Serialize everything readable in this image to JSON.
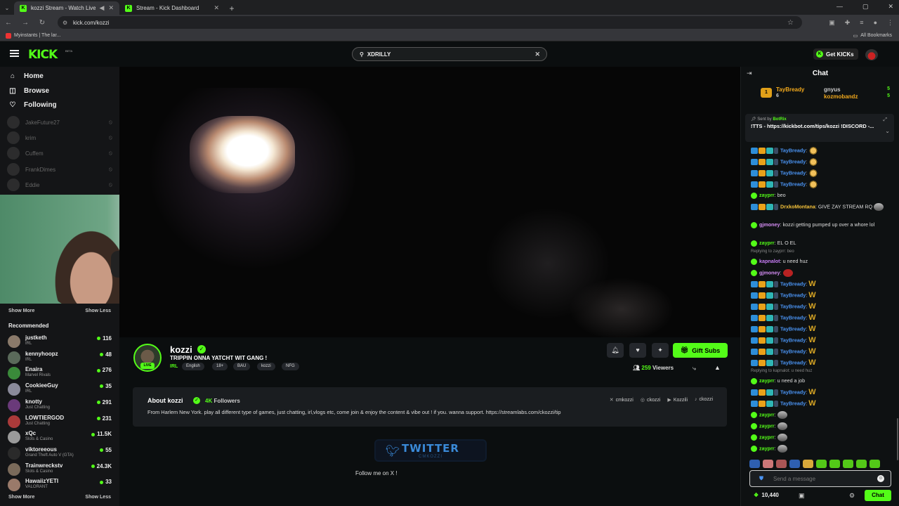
{
  "browser": {
    "tabs": [
      {
        "title": "kozzi Stream - Watch Live o"
      },
      {
        "title": "Stream - Kick Dashboard"
      }
    ],
    "url": "kick.com/kozzi",
    "bookmark": "Myinstants | The lar...",
    "all_bookmarks": "All Bookmarks"
  },
  "header": {
    "logo": "KICK",
    "beta": "BETA",
    "search_value": "XDRILLY",
    "get_kicks": "Get KICKs"
  },
  "sidebar": {
    "nav": [
      {
        "label": "Home",
        "icon": "home-icon"
      },
      {
        "label": "Browse",
        "icon": "compass-icon"
      },
      {
        "label": "Following",
        "icon": "heart-icon"
      }
    ],
    "following": [
      "JakeFuture27",
      "krim",
      "Cuffem",
      "FrankDimes",
      "Eddie"
    ],
    "show_more": "Show More",
    "show_less": "Show Less",
    "recommended_title": "Recommended",
    "recommended": [
      {
        "name": "justketh",
        "category": "IRL",
        "viewers": "116",
        "color": "#8a7a6a"
      },
      {
        "name": "kennyhoopz",
        "category": "IRL",
        "viewers": "48",
        "color": "#5a6a5a"
      },
      {
        "name": "Enaira",
        "category": "Marvel Rivals",
        "viewers": "276",
        "color": "#3a8a3a"
      },
      {
        "name": "CookieeGuy",
        "category": "IRL",
        "viewers": "35",
        "color": "#8a8a9a"
      },
      {
        "name": "knotty",
        "category": "Just Chatting",
        "viewers": "291",
        "color": "#6a3a7a"
      },
      {
        "name": "LOWTIERGOD",
        "category": "Just Chatting",
        "viewers": "231",
        "color": "#aa3a3a"
      },
      {
        "name": "xQc",
        "category": "Slots & Casino",
        "viewers": "11.5K",
        "color": "#9a9a9a"
      },
      {
        "name": "viktoreeous",
        "category": "Grand Theft Auto V (GTA)",
        "viewers": "55",
        "color": "#2a2a2a"
      },
      {
        "name": "Trainwreckstv",
        "category": "Slots & Casino",
        "viewers": "24.3K",
        "color": "#7a6a5a"
      },
      {
        "name": "HawaiizYETI",
        "category": "VALORANT",
        "viewers": "33",
        "color": "#9a7a6a"
      }
    ]
  },
  "stream": {
    "channel": "kozzi",
    "live": "LIVE",
    "title": "TRIPPIN ONNA YATCHT WIT GANG !",
    "category": "IRL",
    "tags": [
      "English",
      "18+",
      "BAU",
      "kozzi",
      "NFG"
    ],
    "gift_subs": "Gift Subs",
    "viewers": "259",
    "viewers_label": "Viewers"
  },
  "about": {
    "title": "About kozzi",
    "followers": "4K",
    "followers_label": "Followers",
    "socials": [
      {
        "icon": "x-icon",
        "glyph": "✕",
        "label": "cmkozzi"
      },
      {
        "icon": "instagram-icon",
        "glyph": "◎",
        "label": "ckozzi"
      },
      {
        "icon": "youtube-icon",
        "glyph": "▶",
        "label": "Kozzili"
      },
      {
        "icon": "tiktok-icon",
        "glyph": "♪",
        "label": "ckozzi"
      }
    ],
    "description": "From Harlem New York. play all different type of games, just chatting, irl,vlogs etc, come join & enjoy the content & vibe out ! if you. wanna support. https://streamlabs.com/ckozzi/tip"
  },
  "panel": {
    "twitter": "TWITTER",
    "handle": "CMKOZZI",
    "follow_text": "Follow me on X !"
  },
  "chat": {
    "title": "Chat",
    "leaderboard": [
      {
        "name": "TayBready",
        "score": "6"
      },
      {
        "name": "gnyus",
        "score": "5"
      },
      {
        "name": "kozmobandz",
        "score": "5"
      }
    ],
    "pinned": {
      "sent_by": "Sent by",
      "bot": "BotRix",
      "message": "!TTS - https://kickbot.com/tips/kozzi !DISCORD -..."
    },
    "messages": [
      {
        "user": "TayBready",
        "cls": "u-tay",
        "text": "",
        "emote": "e-face",
        "badges": true
      },
      {
        "user": "TayBready",
        "cls": "u-tay",
        "text": "",
        "emote": "e-face",
        "badges": true
      },
      {
        "user": "TayBready",
        "cls": "u-tay",
        "text": "",
        "emote": "e-face",
        "badges": true
      },
      {
        "user": "TayBready",
        "cls": "u-tay",
        "text": "",
        "emote": "e-face",
        "badges": true
      },
      {
        "user": "zayprr",
        "cls": "u-zay",
        "text": "beo",
        "emote": "",
        "badges": false
      },
      {
        "user": "DrxkoMontana",
        "cls": "u-drx",
        "text": "GIVE ZAY STREAM RQ",
        "emote": "e-pic",
        "badges": true,
        "two_line": true
      },
      {
        "user": "gjmoney",
        "cls": "u-gj",
        "text": "kozzi getting pumped up over a whore lol",
        "emote": "",
        "badges": false,
        "two_line": true
      },
      {
        "user": "zayprr",
        "cls": "u-zay",
        "text": "EL O EL",
        "emote": "",
        "badges": false
      },
      {
        "user": "kapnalot",
        "cls": "u-kap",
        "text": "u need huz",
        "emote": "",
        "badges": false,
        "reply": "Replying to zayprr: beo"
      },
      {
        "user": "gjmoney",
        "cls": "u-gj",
        "text": "",
        "emote": "e-red",
        "badges": false
      },
      {
        "user": "TayBready",
        "cls": "u-tay",
        "text": "",
        "emote": "e-w",
        "badges": true
      },
      {
        "user": "TayBready",
        "cls": "u-tay",
        "text": "",
        "emote": "e-w",
        "badges": true
      },
      {
        "user": "TayBready",
        "cls": "u-tay",
        "text": "",
        "emote": "e-w",
        "badges": true
      },
      {
        "user": "TayBready",
        "cls": "u-tay",
        "text": "",
        "emote": "e-w",
        "badges": true
      },
      {
        "user": "TayBready",
        "cls": "u-tay",
        "text": "",
        "emote": "e-w",
        "badges": true
      },
      {
        "user": "TayBready",
        "cls": "u-tay",
        "text": "",
        "emote": "e-w",
        "badges": true
      },
      {
        "user": "TayBready",
        "cls": "u-tay",
        "text": "",
        "emote": "e-w",
        "badges": true
      },
      {
        "user": "TayBready",
        "cls": "u-tay",
        "text": "",
        "emote": "e-w",
        "badges": true
      },
      {
        "user": "zayprr",
        "cls": "u-zay",
        "text": "u need a job",
        "emote": "",
        "badges": false,
        "reply": "Replying to kapnalot: u need huz"
      },
      {
        "user": "TayBready",
        "cls": "u-tay",
        "text": "",
        "emote": "e-w",
        "badges": true
      },
      {
        "user": "TayBready",
        "cls": "u-tay",
        "text": "",
        "emote": "e-w",
        "badges": true
      },
      {
        "user": "zayprr",
        "cls": "u-zay",
        "text": "",
        "emote": "e-pic",
        "badges": false
      },
      {
        "user": "zayprr",
        "cls": "u-zay",
        "text": "",
        "emote": "e-pic",
        "badges": false
      },
      {
        "user": "zayprr",
        "cls": "u-zay",
        "text": "",
        "emote": "e-pic",
        "badges": false
      },
      {
        "user": "zayprr",
        "cls": "u-zay",
        "text": "",
        "emote": "e-pic",
        "badges": false
      }
    ],
    "input_placeholder": "Send a message",
    "kicks_balance": "10,440",
    "send_label": "Chat"
  }
}
